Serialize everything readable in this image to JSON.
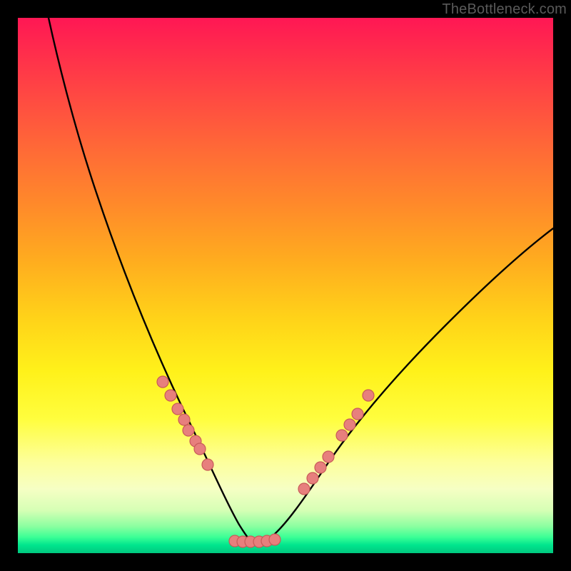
{
  "watermark": {
    "text": "TheBottleneck.com"
  },
  "chart_data": {
    "type": "line",
    "title": "",
    "xlabel": "",
    "ylabel": "",
    "xlim": [
      0,
      100
    ],
    "ylim": [
      0,
      100
    ],
    "grid": false,
    "legend": false,
    "note": "Axes unlabeled; values estimated from pixel geometry on a 0–100 normalized scale. The black curve is a V-shaped profile with minimum near x≈44. Dots sit on the curve roughly in the y≈12–30 band plus a flat run at the trough.",
    "series": [
      {
        "name": "curve",
        "style": "black-line",
        "x": [
          5.7,
          8,
          12,
          16,
          20,
          24,
          28,
          32,
          36,
          40,
          42,
          43,
          44,
          46,
          48,
          52,
          56,
          62,
          70,
          80,
          90,
          100
        ],
        "y": [
          100,
          91,
          76,
          62,
          50,
          40,
          31,
          23,
          15,
          7,
          3.5,
          2.3,
          2.1,
          2.3,
          3.0,
          5.5,
          9.5,
          16,
          26,
          38,
          49,
          59
        ]
      },
      {
        "name": "dots-left-slope",
        "style": "salmon-dot",
        "x": [
          27.0,
          28.5,
          29.8,
          31.0,
          31.8,
          33.2,
          34.0,
          35.5
        ],
        "y": [
          32.0,
          29.5,
          27.0,
          25.0,
          23.0,
          21.0,
          19.5,
          16.5
        ]
      },
      {
        "name": "dots-trough",
        "style": "salmon-dot",
        "x": [
          40.5,
          42.0,
          43.5,
          45.0,
          46.5,
          48.0
        ],
        "y": [
          2.3,
          2.1,
          2.1,
          2.1,
          2.2,
          2.5
        ]
      },
      {
        "name": "dots-right-slope",
        "style": "salmon-dot",
        "x": [
          53.5,
          55.0,
          56.5,
          58.0,
          60.5,
          62.0,
          63.5,
          65.5
        ],
        "y": [
          12.0,
          14.0,
          16.0,
          18.0,
          22.0,
          24.0,
          26.0,
          29.5
        ]
      }
    ]
  },
  "colors": {
    "curve": "#000000",
    "dot_fill": "#e77f7d",
    "dot_stroke": "#c85a58"
  }
}
